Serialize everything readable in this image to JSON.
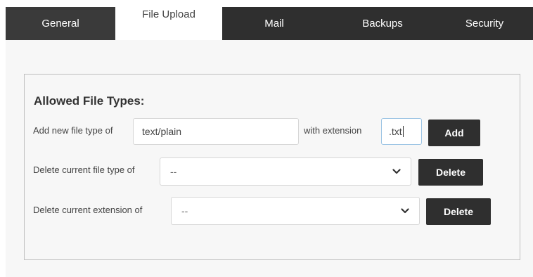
{
  "tabs": {
    "general": "General",
    "file_upload": "File Upload",
    "mail": "Mail",
    "backups": "Backups",
    "security": "Security"
  },
  "panel": {
    "title": "Allowed File Types:",
    "add_row": {
      "label": "Add new file type of",
      "file_type_value": "text/plain",
      "with_label": "with extension",
      "extension_value": ".txt",
      "button": "Add"
    },
    "delete_type_row": {
      "label": "Delete current file type of",
      "selected": "--",
      "button": "Delete"
    },
    "delete_ext_row": {
      "label": "Delete current extension of",
      "selected": "--",
      "button": "Delete"
    }
  },
  "icons": {
    "dropdown": "chevron-down-icon"
  },
  "colors": {
    "tab_bar": "#2f2f2f",
    "active_tab": "#ffffff",
    "button": "#2f2f2f",
    "panel_border": "#bfbfbf"
  }
}
